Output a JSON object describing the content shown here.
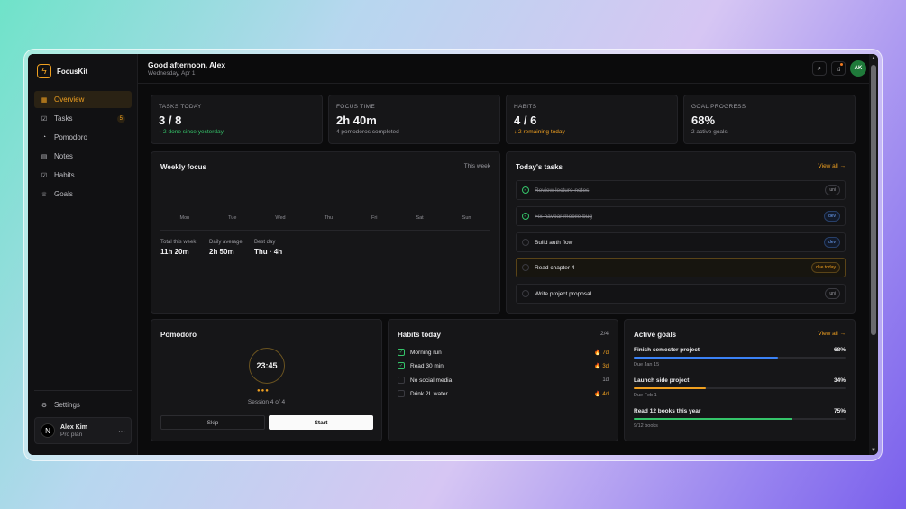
{
  "sidebar": {
    "brand": "FocusKit",
    "items": [
      {
        "label": "Overview",
        "icon": "grid-icon",
        "active": true
      },
      {
        "label": "Tasks",
        "icon": "check-square-icon",
        "badge": "5"
      },
      {
        "label": "Pomodoro",
        "icon": "timer-icon"
      },
      {
        "label": "Notes",
        "icon": "note-icon"
      },
      {
        "label": "Habits",
        "icon": "habit-check-icon"
      },
      {
        "label": "Goals",
        "icon": "trophy-icon"
      }
    ],
    "settings": "Settings",
    "user": {
      "initial": "N",
      "name": "Alex Kim",
      "plan": "Pro plan",
      "more": "···"
    }
  },
  "header": {
    "greeting": "Good afternoon, Alex",
    "date": "Wednesday, Apr 1",
    "avatar": "AK"
  },
  "stats": [
    {
      "label": "TASKS TODAY",
      "value": "3 / 8",
      "sub": "↑ 2 done since yesterday",
      "sub_tone": "green"
    },
    {
      "label": "FOCUS TIME",
      "value": "2h 40m",
      "sub": "4 pomodoros completed",
      "sub_tone": "muted"
    },
    {
      "label": "HABITS",
      "value": "4 / 6",
      "sub": "↓ 2 remaining today",
      "sub_tone": "amber"
    },
    {
      "label": "GOAL PROGRESS",
      "value": "68%",
      "sub": "2 active goals",
      "sub_tone": "muted"
    }
  ],
  "weekly_focus": {
    "title": "Weekly focus",
    "range": "This week",
    "days": [
      "Mon",
      "Tue",
      "Wed",
      "Thu",
      "Fri",
      "Sat",
      "Sun"
    ],
    "stats": [
      {
        "label": "Total this week",
        "value": "11h 20m"
      },
      {
        "label": "Daily average",
        "value": "2h 50m"
      },
      {
        "label": "Best day",
        "value": "Thu · 4h"
      }
    ]
  },
  "todays_tasks": {
    "title": "Today's tasks",
    "view_all": "View all →",
    "items": [
      {
        "label": "Review lecture notes",
        "done": true,
        "tag": "uni",
        "tag_style": "plain"
      },
      {
        "label": "Fix navbar mobile bug",
        "done": true,
        "tag": "dev",
        "tag_style": "dev"
      },
      {
        "label": "Build auth flow",
        "done": false,
        "tag": "dev",
        "tag_style": "dev"
      },
      {
        "label": "Read chapter 4",
        "done": false,
        "tag": "due today",
        "tag_style": "due"
      },
      {
        "label": "Write project proposal",
        "done": false,
        "tag": "uni",
        "tag_style": "plain"
      }
    ]
  },
  "pomodoro": {
    "title": "Pomodoro",
    "time": "23:45",
    "dots": "●●●",
    "session": "Session 4 of 4",
    "skip": "Skip",
    "start": "Start"
  },
  "habits": {
    "title": "Habits today",
    "count": "2/4",
    "items": [
      {
        "label": "Morning run",
        "done": true,
        "streak": "7d",
        "fire": true
      },
      {
        "label": "Read 30 min",
        "done": true,
        "streak": "3d",
        "fire": true
      },
      {
        "label": "No social media",
        "done": false,
        "streak": "1d",
        "fire": false
      },
      {
        "label": "Drink 2L water",
        "done": false,
        "streak": "4d",
        "fire": true
      }
    ]
  },
  "goals": {
    "title": "Active goals",
    "view_all": "View all →",
    "items": [
      {
        "name": "Finish semester project",
        "pct": "68%",
        "progress": 0.68,
        "due": "Due Jan 15",
        "color": "#3b82f6"
      },
      {
        "name": "Launch side project",
        "pct": "34%",
        "progress": 0.34,
        "due": "Due Feb 1",
        "color": "#f0a020"
      },
      {
        "name": "Read 12 books this year",
        "pct": "75%",
        "progress": 0.75,
        "due": "9/12 books",
        "color": "#35c46a"
      }
    ]
  }
}
